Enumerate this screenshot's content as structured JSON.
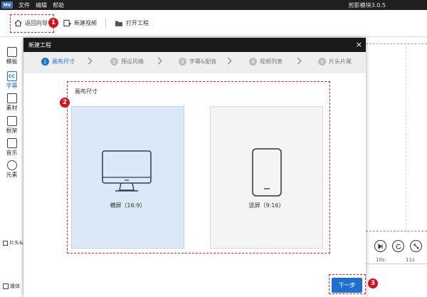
{
  "app": {
    "logo": "MV",
    "menus": [
      "文件",
      "编辑",
      "帮助"
    ],
    "title": "剪影模块3.0.5"
  },
  "toolbar": {
    "back_label": "返回向导",
    "new_video_label": "新建视频",
    "open_project_label": "打开工程"
  },
  "rail": {
    "items": [
      {
        "label": "模板",
        "icon": "layout-icon"
      },
      {
        "label": "字幕",
        "icon": "cc-icon"
      },
      {
        "label": "素材",
        "icon": "image-icon"
      },
      {
        "label": "框架",
        "icon": "frame-icon"
      },
      {
        "label": "音乐",
        "icon": "music-icon"
      },
      {
        "label": "元素",
        "icon": "elements-icon"
      }
    ],
    "cc_glyph": "CC",
    "bottom1": "片头&",
    "bottom2": "媒体"
  },
  "timeline": {
    "tick1": "10s",
    "tick2": "11s"
  },
  "dialog": {
    "title": "新建工程",
    "close": "×",
    "steps": [
      {
        "num": "1",
        "label": "画布尺寸"
      },
      {
        "num": "2",
        "label": "预设风格"
      },
      {
        "num": "3",
        "label": "字幕&配音"
      },
      {
        "num": "4",
        "label": "视频列表"
      },
      {
        "num": "5",
        "label": "片头片尾"
      }
    ],
    "section_label": "画布尺寸",
    "landscape_label": "横屏（16:9）",
    "portrait_label": "竖屏（9:16）",
    "next_label": "下一步"
  },
  "annotations": [
    "1",
    "2",
    "3"
  ],
  "colors": {
    "accent": "#1f6fd1",
    "selected_card": "#dae8f7",
    "annotation_red": "#d4121a"
  }
}
